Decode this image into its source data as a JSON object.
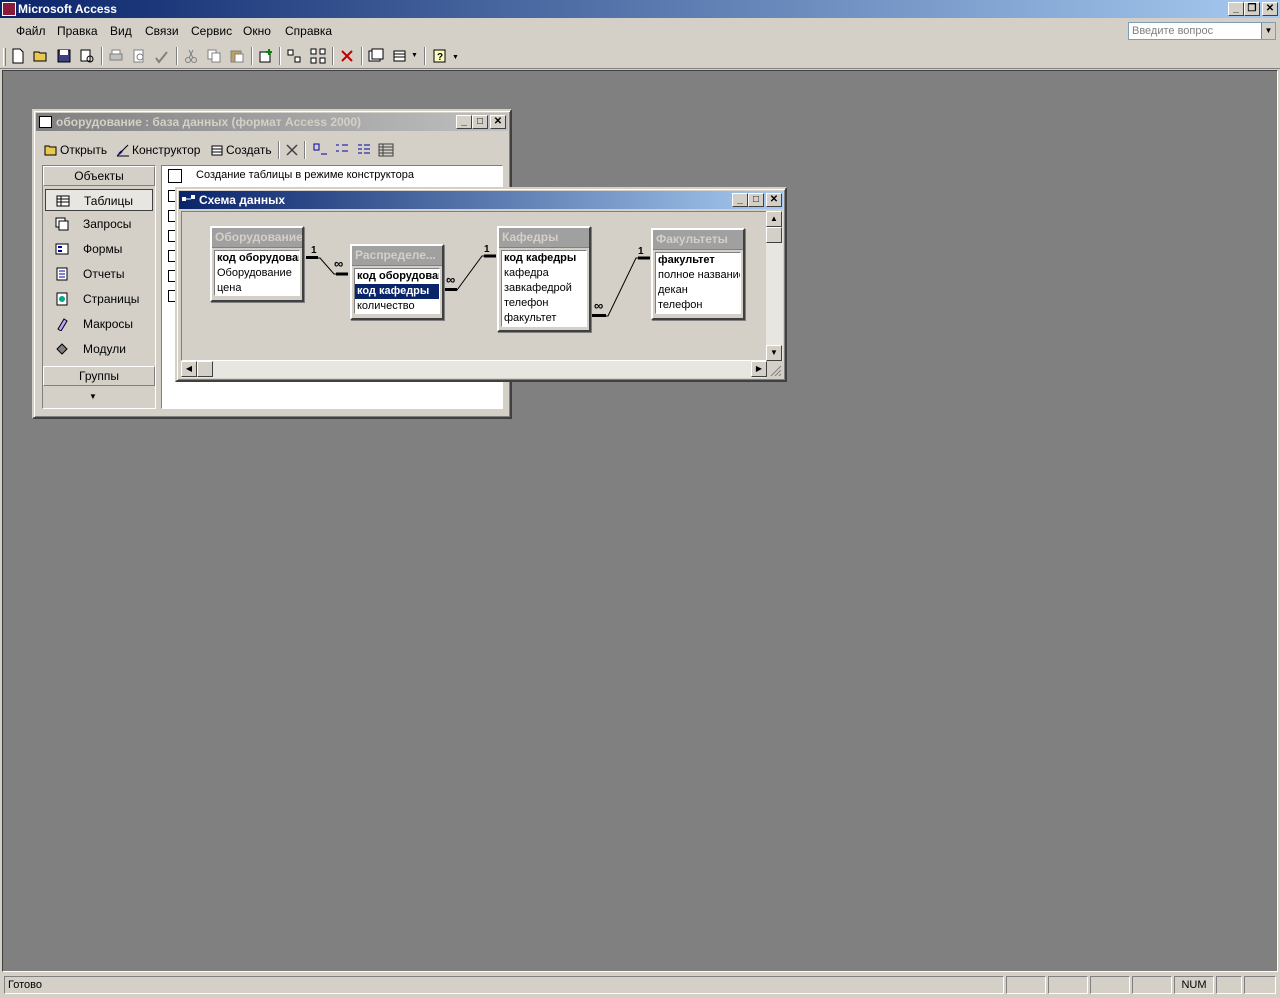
{
  "app": {
    "title": "Microsoft Access"
  },
  "menu": [
    "Файл",
    "Правка",
    "Вид",
    "Связи",
    "Сервис",
    "Окно",
    "Справка"
  ],
  "help_search": {
    "placeholder": "Введите вопрос"
  },
  "db_window": {
    "title": "оборудование : база данных (формат Access 2000)",
    "toolbar": {
      "open": "Открыть",
      "design": "Конструктор",
      "create": "Создать"
    },
    "objects_header": "Объекты",
    "objects": [
      "Таблицы",
      "Запросы",
      "Формы",
      "Отчеты",
      "Страницы",
      "Макросы",
      "Модули"
    ],
    "selected_object": "Таблицы",
    "groups_header": "Группы",
    "list_items": [
      "Создание таблицы в режиме конструктора"
    ]
  },
  "rel_window": {
    "title": "Схема данных",
    "tables": [
      {
        "name": "Оборудование",
        "fields": [
          {
            "text": "код оборудован",
            "key": true
          },
          {
            "text": "Оборудование"
          },
          {
            "text": "цена"
          }
        ]
      },
      {
        "name": "Распределе...",
        "fields": [
          {
            "text": "код оборудован",
            "key": true
          },
          {
            "text": "код кафедры",
            "key": true,
            "selected": true
          },
          {
            "text": "количество"
          }
        ]
      },
      {
        "name": "Кафедры",
        "fields": [
          {
            "text": "код кафедры",
            "key": true
          },
          {
            "text": "кафедра"
          },
          {
            "text": "завкафедрой"
          },
          {
            "text": "телефон"
          },
          {
            "text": "факультет"
          }
        ]
      },
      {
        "name": "Факультеты",
        "fields": [
          {
            "text": "факультет",
            "key": true
          },
          {
            "text": "полное название"
          },
          {
            "text": "декан"
          },
          {
            "text": "телефон"
          }
        ]
      }
    ],
    "relations": [
      {
        "one": "1",
        "many": "∞"
      },
      {
        "one": "1",
        "many": "∞"
      },
      {
        "one": "1",
        "many": "∞"
      }
    ]
  },
  "status": {
    "text": "Готово",
    "num": "NUM"
  }
}
